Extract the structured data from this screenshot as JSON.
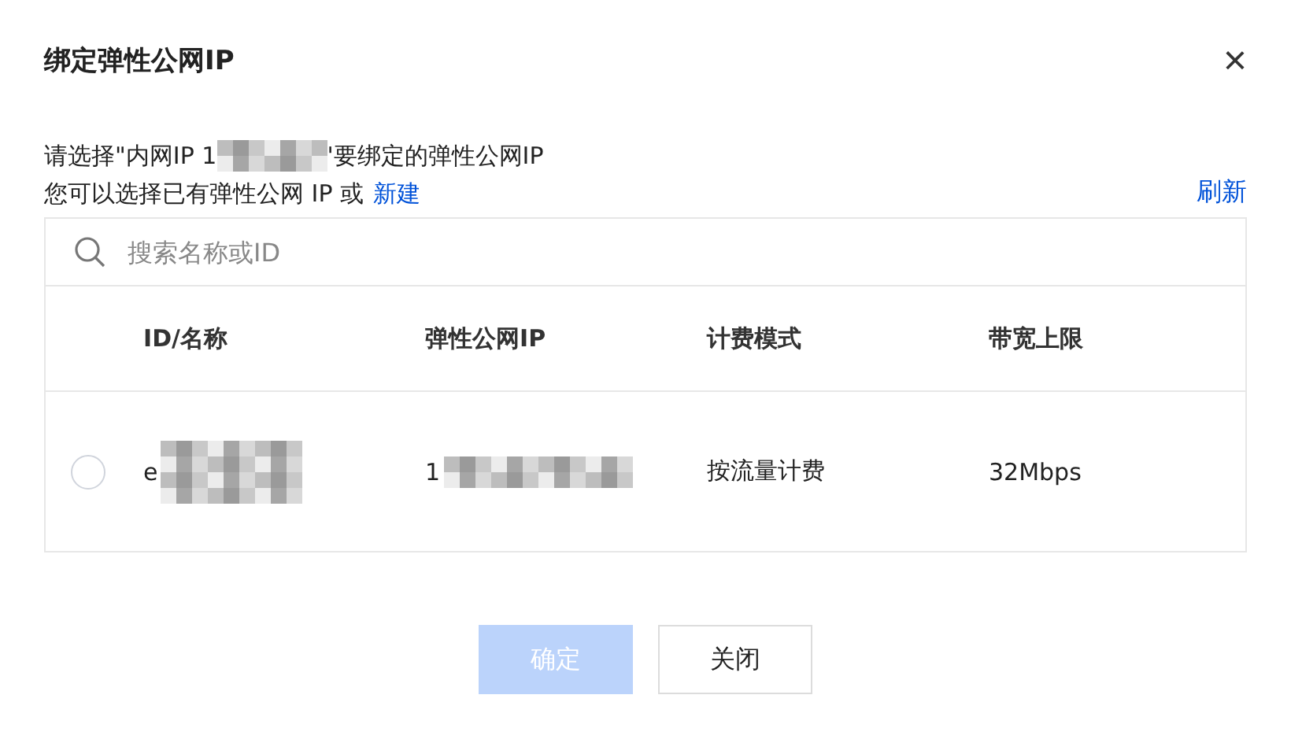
{
  "dialog": {
    "title": "绑定弹性公网IP",
    "close": "×"
  },
  "prompt": {
    "before_mask": "请选择\"内网IP 1",
    "after_mask": "'要绑定的弹性公网IP"
  },
  "hint": {
    "text": "您可以选择已有弹性公网 IP 或",
    "link": "新建"
  },
  "refresh": "刷新",
  "search": {
    "placeholder": "搜索名称或ID"
  },
  "table": {
    "columns": [
      "ID/名称",
      "弹性公网IP",
      "计费模式",
      "带宽上限"
    ],
    "rows": [
      {
        "selected": false,
        "id": "e",
        "ip": "1",
        "billing": "按流量计费",
        "bandwidth": "32Mbps"
      }
    ]
  },
  "buttons": [
    {
      "label": "确定",
      "kind": "primary",
      "disabled": true
    },
    {
      "label": "关闭",
      "kind": "default",
      "disabled": false
    }
  ]
}
